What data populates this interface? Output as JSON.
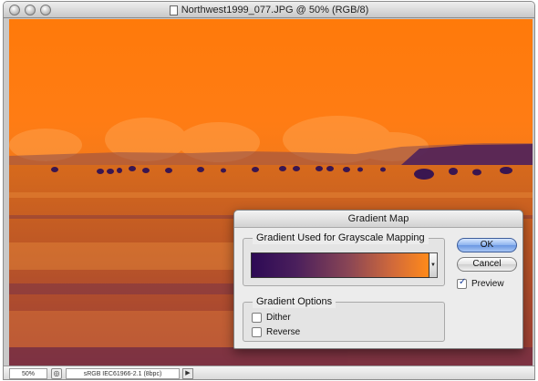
{
  "window": {
    "title": "Northwest1999_077.JPG @ 50% (RGB/8)"
  },
  "statusbar": {
    "zoom": "50%",
    "profile": "sRGB IEC61966-2.1 (8bpc)",
    "arrow_glyph": "▶",
    "icon_glyph": "◎"
  },
  "dialog": {
    "title": "Gradient Map",
    "gradient_group_label": "Gradient Used for Grayscale Mapping",
    "gradient_drop_glyph": "▼",
    "gradient_colors": [
      "#2d0a55",
      "#ff8a1a"
    ],
    "options_group_label": "Gradient Options",
    "dither_label": "Dither",
    "dither_checked": false,
    "reverse_label": "Reverse",
    "reverse_checked": false,
    "ok_label": "OK",
    "cancel_label": "Cancel",
    "preview_label": "Preview",
    "preview_checked": true
  },
  "colors": {
    "sky": "#ff7a0a",
    "ground": "#c45a22",
    "shadow": "#4a1f5c"
  }
}
